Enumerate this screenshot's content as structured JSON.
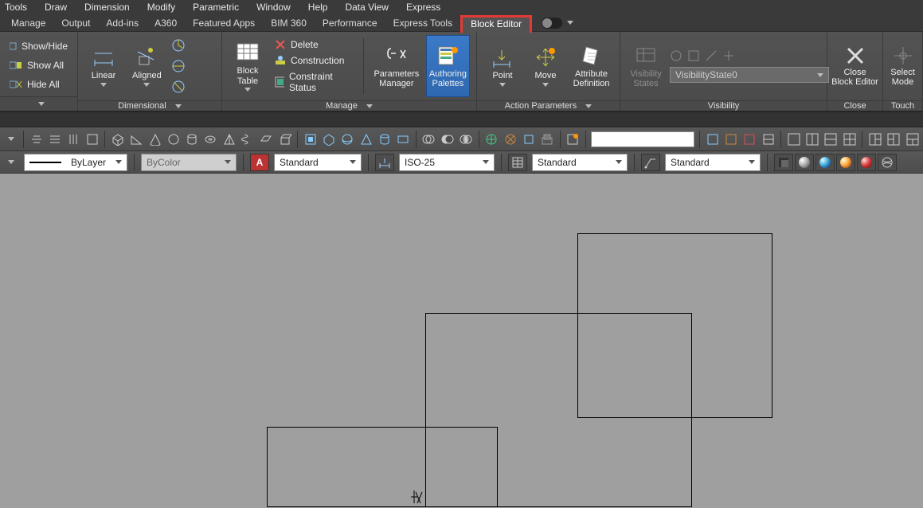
{
  "menu": [
    "Tools",
    "Draw",
    "Dimension",
    "Modify",
    "Parametric",
    "Window",
    "Help",
    "Data View",
    "Express"
  ],
  "tabs": [
    "Manage",
    "Output",
    "Add-ins",
    "A360",
    "Featured Apps",
    "BIM 360",
    "Performance",
    "Express Tools",
    "Block Editor"
  ],
  "panels": {
    "p0_items": [
      "Show/Hide",
      "Show All",
      "Hide All"
    ],
    "dimensional": {
      "title": "Dimensional",
      "linear": "Linear",
      "aligned": "Aligned"
    },
    "manage": {
      "title": "Manage",
      "block_table": "Block\nTable",
      "delete": "Delete",
      "construction": "Construction",
      "constraint_status": "Constraint Status",
      "param_mgr": "Parameters\nManager",
      "auth_pal": "Authoring\nPalettes"
    },
    "action": {
      "title": "Action Parameters",
      "point": "Point",
      "move": "Move",
      "attr_def": "Attribute\nDefinition"
    },
    "visibility": {
      "title": "Visibility",
      "combo": "VisibilityState0",
      "states": "Visibility\nStates"
    },
    "close": {
      "title": "Close",
      "btn": "Close\nBlock Editor"
    },
    "touch": {
      "title": "Touch",
      "btn": "Select\nMode"
    }
  },
  "propbar": {
    "bylayer": "ByLayer",
    "bycolor": "ByColor",
    "standard": "Standard",
    "iso25": "ISO-25"
  }
}
